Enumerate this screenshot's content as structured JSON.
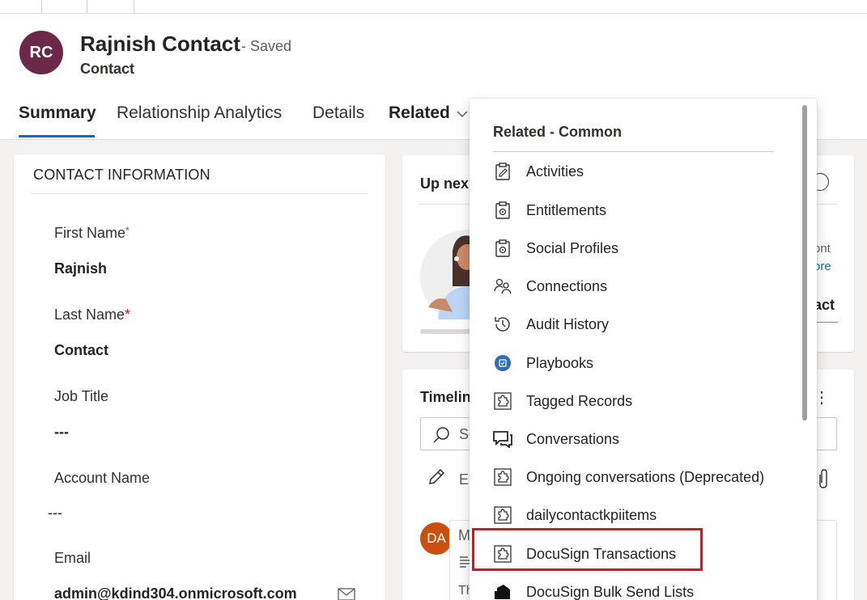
{
  "header": {
    "avatar_initials": "RC",
    "record_name": "Rajnish Contact",
    "save_status": "- Saved",
    "entity_name": "Contact",
    "tabs": [
      {
        "label": "Summary"
      },
      {
        "label": "Relationship Analytics"
      },
      {
        "label": "Details"
      },
      {
        "label": "Related"
      }
    ]
  },
  "contact_info": {
    "section_title": "CONTACT INFORMATION",
    "fields": [
      {
        "label": "First Name",
        "required_marker": "*",
        "value": "Rajnish"
      },
      {
        "label": "Last Name",
        "required_marker": "*",
        "value": "Contact"
      },
      {
        "label": "Job Title",
        "value": "---"
      },
      {
        "label": "Account Name",
        "value": "---"
      },
      {
        "label": "Email",
        "value": "admin@kdind304.onmicrosoft.com"
      }
    ]
  },
  "up_next": {
    "title_fragment": "Up nex",
    "snippet_1": "ont",
    "snippet_2": "ore",
    "snippet_3": "act"
  },
  "timeline": {
    "title_fragment": "Timelin",
    "search_placeholder_fragment": "Se",
    "note_placeholder_fragment": "Er",
    "more_glyph": "⋮",
    "entry_avatar_initials": "DA",
    "entry_title_fragment": "M",
    "entry_body_fragment": "Th"
  },
  "related_menu": {
    "heading": "Related - Common",
    "items": [
      {
        "label": "Activities",
        "icon": "clipboard-icon"
      },
      {
        "label": "Entitlements",
        "icon": "entitlement-icon"
      },
      {
        "label": "Social Profiles",
        "icon": "social-profile-icon"
      },
      {
        "label": "Connections",
        "icon": "people-icon"
      },
      {
        "label": "Audit History",
        "icon": "history-icon"
      },
      {
        "label": "Playbooks",
        "icon": "playbook-icon"
      },
      {
        "label": "Tagged Records",
        "icon": "puzzle-icon"
      },
      {
        "label": "Conversations",
        "icon": "chat-icon"
      },
      {
        "label": "Ongoing conversations (Deprecated)",
        "icon": "puzzle-icon"
      },
      {
        "label": "dailycontactkpiitems",
        "icon": "puzzle-icon"
      },
      {
        "label": "DocuSign Transactions",
        "icon": "puzzle-icon",
        "highlighted": true
      },
      {
        "label": "DocuSign Bulk Send Lists",
        "icon": "docusign-icon"
      }
    ]
  },
  "colors": {
    "avatar_rc": "#6b2848",
    "avatar_da": "#ca5010",
    "accent": "#0f6cbd",
    "highlight": "#e3101a",
    "required_red": "#c50f1f"
  }
}
